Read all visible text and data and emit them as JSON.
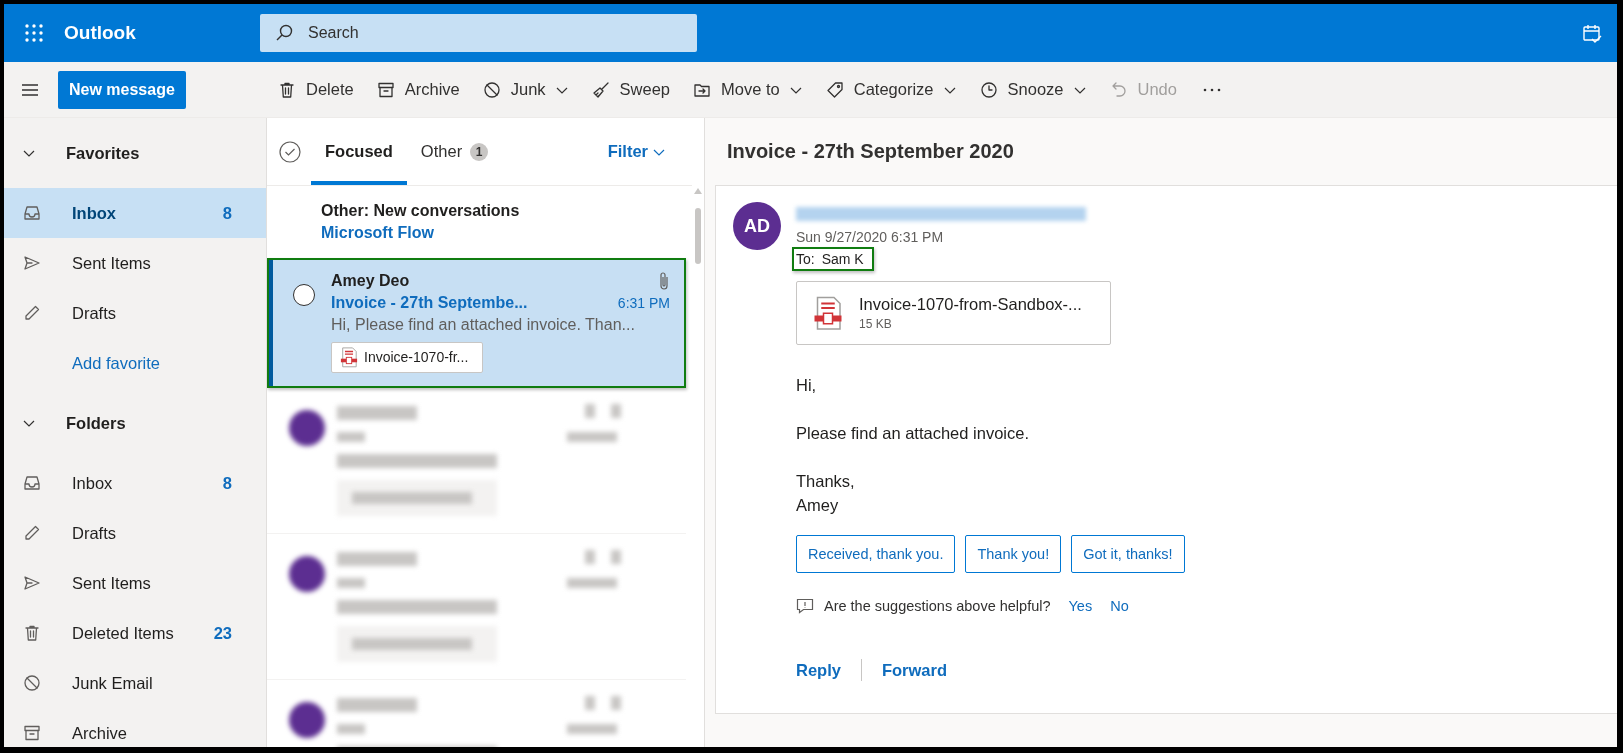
{
  "topbar": {
    "app_name": "Outlook",
    "search": {
      "placeholder": "Search"
    }
  },
  "toolbar": {
    "new_message": "New message",
    "items": [
      {
        "label": "Delete",
        "dropdown": false,
        "disabled": false
      },
      {
        "label": "Archive",
        "dropdown": false,
        "disabled": false
      },
      {
        "label": "Junk",
        "dropdown": true,
        "disabled": false
      },
      {
        "label": "Sweep",
        "dropdown": false,
        "disabled": false
      },
      {
        "label": "Move to",
        "dropdown": true,
        "disabled": false
      },
      {
        "label": "Categorize",
        "dropdown": true,
        "disabled": false
      },
      {
        "label": "Snooze",
        "dropdown": true,
        "disabled": false
      },
      {
        "label": "Undo",
        "dropdown": false,
        "disabled": true
      }
    ]
  },
  "sidebar": {
    "sections": [
      {
        "title": "Favorites",
        "expanded": true,
        "items": [
          {
            "kind": "folder",
            "label": "Inbox",
            "count": "8",
            "selected": true
          },
          {
            "kind": "folder",
            "label": "Sent Items",
            "selected": false
          },
          {
            "kind": "folder",
            "label": "Drafts",
            "selected": false
          },
          {
            "kind": "link",
            "label": "Add favorite",
            "selected": false
          }
        ]
      },
      {
        "title": "Folders",
        "expanded": true,
        "items": [
          {
            "kind": "folder",
            "label": "Inbox",
            "count": "8",
            "selected": false
          },
          {
            "kind": "folder",
            "label": "Drafts",
            "selected": false
          },
          {
            "kind": "folder",
            "label": "Sent Items",
            "selected": false
          },
          {
            "kind": "folder",
            "label": "Deleted Items",
            "count": "23",
            "selected": false
          },
          {
            "kind": "folder",
            "label": "Junk Email",
            "selected": false
          },
          {
            "kind": "folder",
            "label": "Archive",
            "selected": false
          }
        ]
      }
    ]
  },
  "message_list": {
    "tabs": [
      {
        "label": "Focused",
        "selected": true
      },
      {
        "label": "Other",
        "badge": "1",
        "selected": false
      }
    ],
    "filter": "Filter",
    "notice": {
      "title": "Other: New conversations",
      "link": "Microsoft Flow"
    },
    "messages": [
      {
        "kind": "message",
        "sender": "Amey Deo",
        "subject": "Invoice - 27th Septembe...",
        "time": "6:31 PM",
        "preview": "Hi, Please find an attached invoice. Than...",
        "attachment": "Invoice-1070-fr...",
        "has_attachment": true,
        "unread": true,
        "selected": true,
        "highlighted": true
      },
      {
        "kind": "redacted"
      },
      {
        "kind": "redacted"
      },
      {
        "kind": "redacted"
      }
    ]
  },
  "reading_pane": {
    "subject": "Invoice - 27th September 2020",
    "avatar": "AD",
    "sender_redacted": true,
    "date": "Sun 9/27/2020 6:31 PM",
    "to_label": "To:",
    "to": "Sam K",
    "to_highlighted": true,
    "attachment": {
      "name": "Invoice-1070-from-Sandbox-...",
      "size": "15 KB"
    },
    "body": [
      "Hi,",
      "Please find an attached invoice.",
      "Thanks,\nAmey"
    ],
    "quick_replies": [
      "Received, thank you.",
      "Thank you!",
      "Got it, thanks!"
    ],
    "feedback": {
      "question": "Are the suggestions above helpful?",
      "yes": "Yes",
      "no": "No"
    },
    "actions": [
      "Reply",
      "Forward"
    ]
  }
}
